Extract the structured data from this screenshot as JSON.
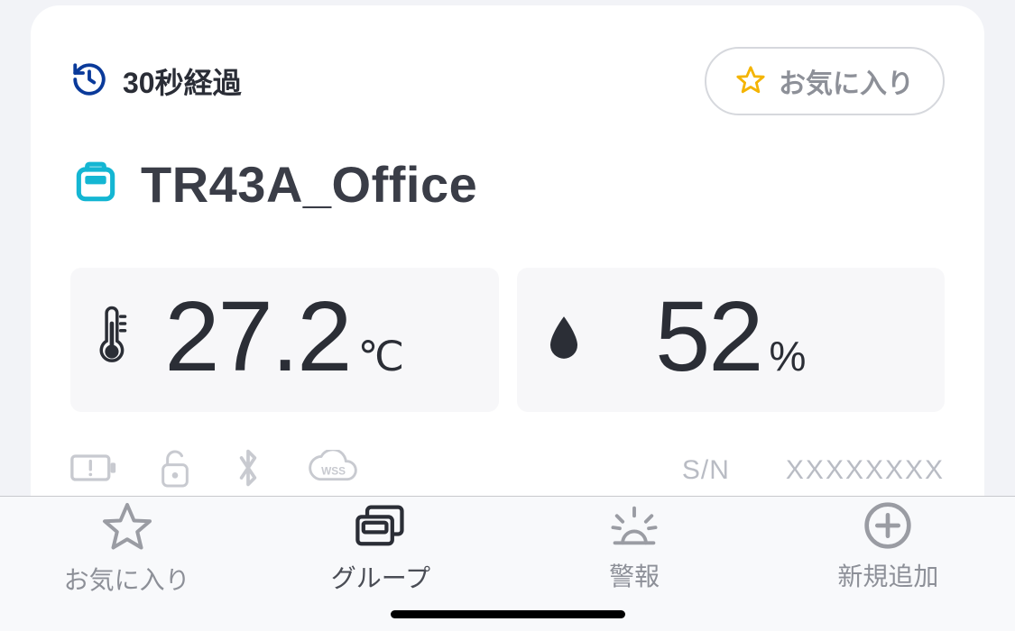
{
  "header": {
    "elapsed": "30秒経過",
    "favorite_label": "お気に入り"
  },
  "device": {
    "name": "TR43A_Office"
  },
  "readings": {
    "temperature": {
      "value": "27.2",
      "unit": "℃"
    },
    "humidity": {
      "value": "52",
      "unit": "%"
    }
  },
  "serial": {
    "label": "S/N",
    "value": "XXXXXXXX"
  },
  "tabs": {
    "favorites": "お気に入り",
    "group": "グループ",
    "alarm": "警報",
    "add": "新規追加"
  }
}
